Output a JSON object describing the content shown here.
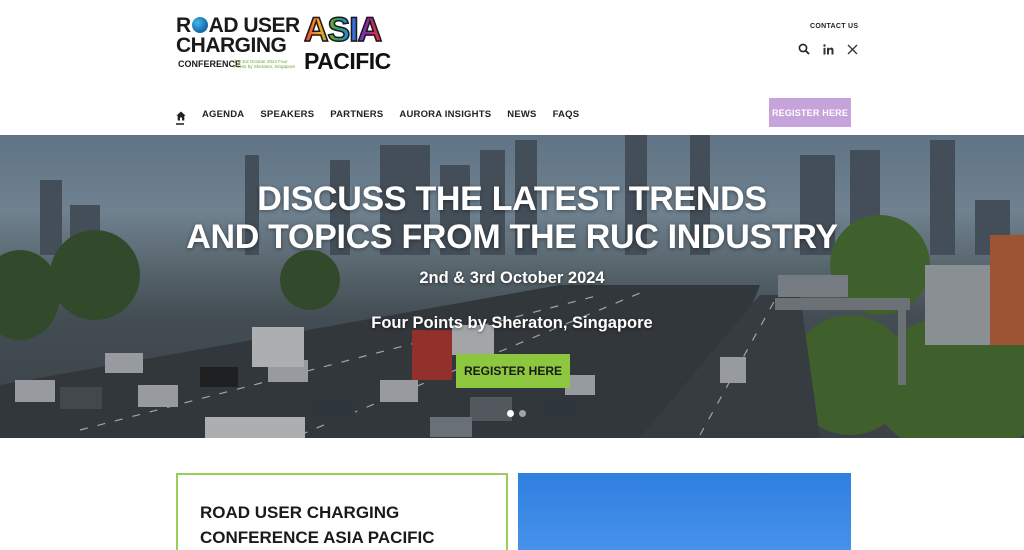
{
  "header": {
    "logo": {
      "line1": "ROAD USER",
      "line2": "CHARGING",
      "line3": "CONFERENCE",
      "dates_small": "2 & 3rd October 2024 Four Points by Sheraton, Singapore",
      "asia": "ASIA",
      "pacific": "PACIFIC"
    },
    "contact_us": "CONTACT US",
    "icons": [
      "search-icon",
      "linkedin-icon",
      "x-twitter-icon"
    ]
  },
  "nav": {
    "items": [
      "AGENDA",
      "SPEAKERS",
      "PARTNERS",
      "AURORA INSIGHTS",
      "NEWS",
      "FAQS"
    ],
    "register": "REGISTER HERE"
  },
  "hero": {
    "headline_line1": "DISCUSS THE LATEST TRENDS",
    "headline_line2": "AND TOPICS FROM THE RUC INDUSTRY",
    "date": "2nd & 3rd October 2024",
    "venue": "Four Points by Sheraton, Singapore",
    "cta": "REGISTER HERE",
    "slide_count": 2,
    "active_slide": 1
  },
  "intro": {
    "title_line1": "ROAD USER CHARGING",
    "title_line2": "CONFERENCE ASIA PACIFIC"
  },
  "colors": {
    "register_top_bg": "#c7a3dc",
    "cta_bg": "#8dc63f",
    "card_border": "#9acd5a",
    "panel_blue": "#2f7fe0"
  }
}
